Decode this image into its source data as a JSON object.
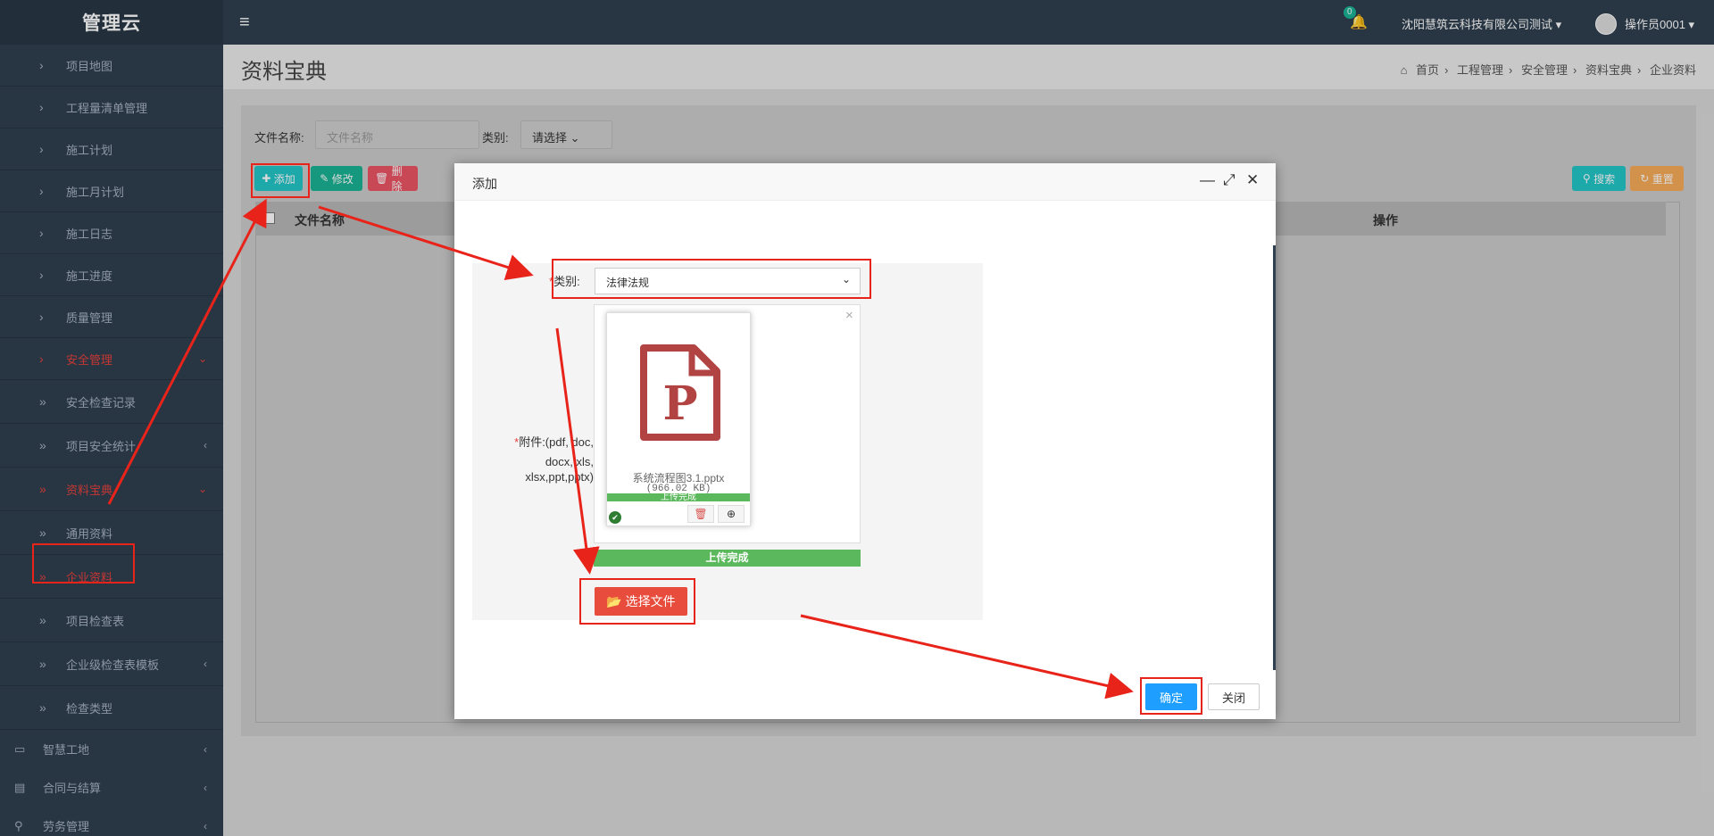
{
  "app": {
    "title": "管理云"
  },
  "topbar": {
    "notification_count": "0",
    "company": "沈阳慧筑云科技有限公司测试 ▾",
    "user": "操作员0001 ▾"
  },
  "sidebar": {
    "items": [
      {
        "label": "项目地图"
      },
      {
        "label": "工程量清单管理"
      },
      {
        "label": "施工计划"
      },
      {
        "label": "施工月计划"
      },
      {
        "label": "施工日志"
      },
      {
        "label": "施工进度"
      },
      {
        "label": "质量管理"
      },
      {
        "label": "安全管理"
      },
      {
        "label": "安全检查记录"
      },
      {
        "label": "项目安全统计"
      },
      {
        "label": "资料宝典"
      },
      {
        "label": "通用资料"
      },
      {
        "label": "企业资料"
      },
      {
        "label": "项目检查表"
      },
      {
        "label": "企业级检查表模板"
      },
      {
        "label": "检查类型"
      }
    ],
    "top_items": [
      {
        "label": "智慧工地"
      },
      {
        "label": "合同与结算"
      },
      {
        "label": "劳务管理"
      }
    ]
  },
  "page": {
    "title": "资料宝典",
    "breadcrumbs": [
      "首页",
      "工程管理",
      "安全管理",
      "资料宝典",
      "企业资料"
    ]
  },
  "filters": {
    "name_label": "文件名称:",
    "name_placeholder": "文件名称",
    "type_label": "类别:",
    "type_value": "请选择"
  },
  "toolbar": {
    "add": "添加",
    "edit": "修改",
    "delete": "删除",
    "search": "搜索",
    "reset": "重置"
  },
  "table": {
    "columns": [
      "文件名称",
      "操作"
    ]
  },
  "modal": {
    "title": "添加",
    "category_label": "类别:",
    "category_value": "法律法规",
    "attachment_label_1": "附件:(pdf, doc,",
    "attachment_label_2": "docx, xls,",
    "attachment_label_3": "xlsx,ppt,pptx)",
    "file_name": "系统流程图3.1.pptx",
    "file_size": "(966.02 KB)",
    "thumb_status": "上传完成",
    "progress_text": "上传完成",
    "choose_file": "选择文件",
    "ok": "确定",
    "close": "关闭"
  },
  "colors": {
    "sidebar_bg": "#2f4050",
    "accent_red": "#e8413c",
    "progress_green": "#5cb85c",
    "ok_blue": "#1e9fff",
    "annotation_red": "#e8231a"
  }
}
